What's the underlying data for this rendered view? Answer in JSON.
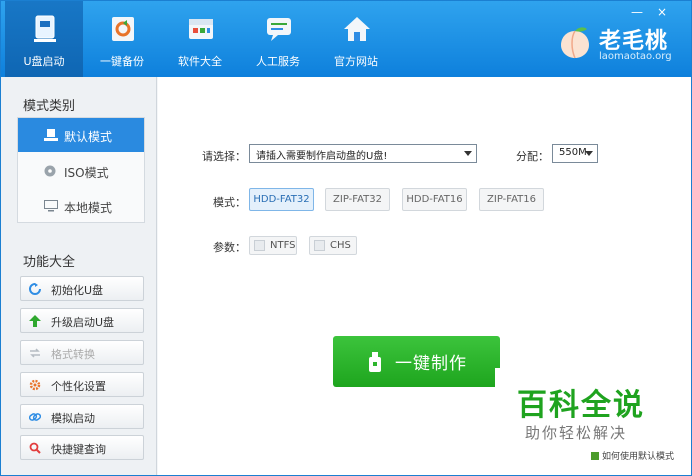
{
  "nav": {
    "items": [
      {
        "label": "U盘启动",
        "icon": "usb-drive-icon"
      },
      {
        "label": "一键备份",
        "icon": "backup-refresh-icon"
      },
      {
        "label": "软件大全",
        "icon": "software-box-icon"
      },
      {
        "label": "人工服务",
        "icon": "chat-service-icon"
      },
      {
        "label": "官方网站",
        "icon": "home-icon"
      }
    ]
  },
  "window": {
    "minimize": "—",
    "close": "×"
  },
  "logo": {
    "brand": "老毛桃",
    "domain": "laomaotao.org"
  },
  "sidebar": {
    "mode_title": "模式类别",
    "modes": [
      {
        "label": "默认模式",
        "icon": "usb-mode-icon"
      },
      {
        "label": "ISO模式",
        "icon": "disc-icon"
      },
      {
        "label": "本地模式",
        "icon": "monitor-icon"
      }
    ],
    "functions_title": "功能大全",
    "functions": [
      {
        "label": "初始化U盘",
        "icon": "refresh-icon"
      },
      {
        "label": "升级启动U盘",
        "icon": "upgrade-arrow-icon"
      },
      {
        "label": "格式转换",
        "icon": "convert-arrows-icon"
      },
      {
        "label": "个性化设置",
        "icon": "gear-icon"
      },
      {
        "label": "模拟启动",
        "icon": "link-icon"
      },
      {
        "label": "快捷键查询",
        "icon": "search-icon"
      }
    ]
  },
  "main": {
    "select_label": "请选择：",
    "disk_select_value": "请插入需要制作启动盘的U盘!",
    "alloc_label": "分配：",
    "alloc_value": "550M",
    "mode_label": "模式：",
    "mode_options": [
      "HDD-FAT32",
      "ZIP-FAT32",
      "HDD-FAT16",
      "ZIP-FAT16"
    ],
    "param_label": "参数：",
    "params": [
      "NTFS",
      "CHS"
    ],
    "make_button": "一键制作",
    "default_mode_tip": "如何使用默认模式"
  },
  "watermark": {
    "main": "百科全说",
    "sub": "助你轻松解决"
  },
  "colors": {
    "header": "#1b8fe6",
    "accent": "#2a8ae0",
    "make_button": "#2cb52c"
  }
}
